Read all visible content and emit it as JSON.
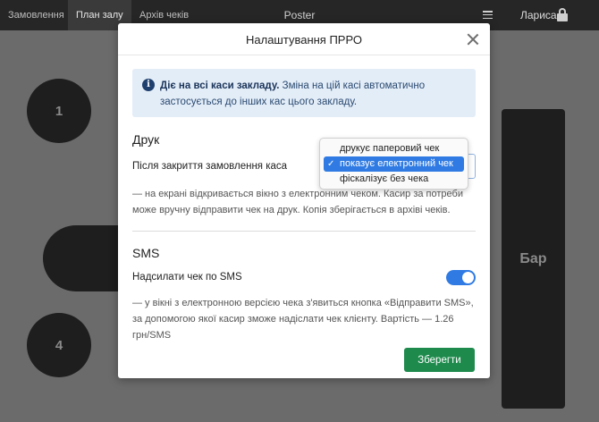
{
  "topbar": {
    "tabs": [
      {
        "label": "Замовлення",
        "active": false
      },
      {
        "label": "План залу",
        "active": true
      },
      {
        "label": "Архів чеків",
        "active": false
      }
    ],
    "brand": "Poster",
    "menu_icon": "hamburger-icon",
    "username": "Лариса",
    "lock_icon": "lock-icon"
  },
  "floor": {
    "tables": [
      {
        "label": "1"
      },
      {
        "label": "4"
      }
    ],
    "bar_label": "Бар"
  },
  "modal": {
    "title": "Налаштування ПРРО",
    "close_icon": "close-icon",
    "info": {
      "icon": "info-icon",
      "bold": "Діє на всі каси закладу.",
      "text": " Зміна на цій касі автоматично застосується до інших кас цього закладу."
    },
    "print": {
      "title": "Друк",
      "row_label": "Після закриття замовлення каса",
      "options": [
        {
          "label": "друкує паперовий чек",
          "selected": false
        },
        {
          "label": "показує електронний чек",
          "selected": true
        },
        {
          "label": "фіскалізує без чека",
          "selected": false
        }
      ],
      "description": "— на екрані відкривається вікно з електронним чеком. Касир за потреби може вручну відправити чек на друк. Копія зберігається в архіві чеків."
    },
    "sms": {
      "title": "SMS",
      "row_label": "Надсилати чек по SMS",
      "enabled": true,
      "description": "— у вікні з електронною версією чека з'явиться кнопка «Відправити SMS», за допомогою якої касир зможе надіслати чек клієнту. Вартість — 1.26 грн/SMS"
    },
    "save_label": "Зберегти"
  },
  "colors": {
    "accent": "#2f7be3",
    "save_button": "#1e8b4d",
    "info_background": "#e3edf8",
    "topbar": "#262626"
  }
}
